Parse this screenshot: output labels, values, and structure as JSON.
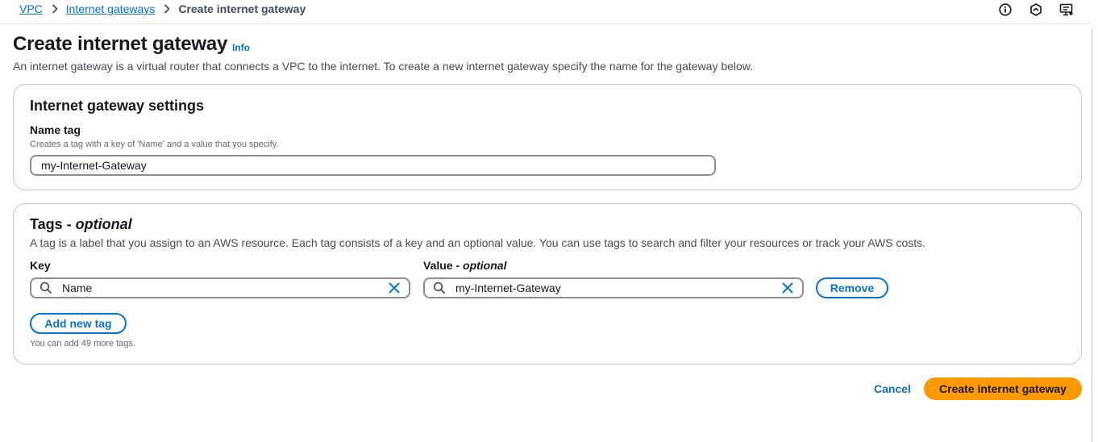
{
  "breadcrumb": {
    "items": [
      "VPC",
      "Internet gateways"
    ],
    "current": "Create internet gateway"
  },
  "header_icons": [
    "info-circle-icon",
    "feedback-icon",
    "screen-help-icon"
  ],
  "page": {
    "title": "Create internet gateway",
    "info_label": "Info",
    "description": "An internet gateway is a virtual router that connects a VPC to the internet. To create a new internet gateway specify the name for the gateway below."
  },
  "settings": {
    "title": "Internet gateway settings",
    "name_tag_label": "Name tag",
    "name_tag_hint": "Creates a tag with a key of 'Name' and a value that you specify.",
    "name_tag_value": "my-Internet-Gateway"
  },
  "tags": {
    "title": "Tags - ",
    "title_optional": "optional",
    "description": "A tag is a label that you assign to an AWS resource. Each tag consists of a key and an optional value. You can use tags to search and filter your resources or track your AWS costs.",
    "key_label": "Key",
    "value_label": "Value - ",
    "value_label_optional": "optional",
    "rows": [
      {
        "key": "Name",
        "value": "my-Internet-Gateway",
        "remove_label": "Remove"
      }
    ],
    "add_label": "Add new tag",
    "remaining_text": "You can add 49 more tags."
  },
  "actions": {
    "cancel_label": "Cancel",
    "submit_label": "Create internet gateway"
  },
  "colors": {
    "link": "#0972d3",
    "primary_button": "#ff9900",
    "border": "#c6c6cd",
    "text": "#16191f"
  }
}
